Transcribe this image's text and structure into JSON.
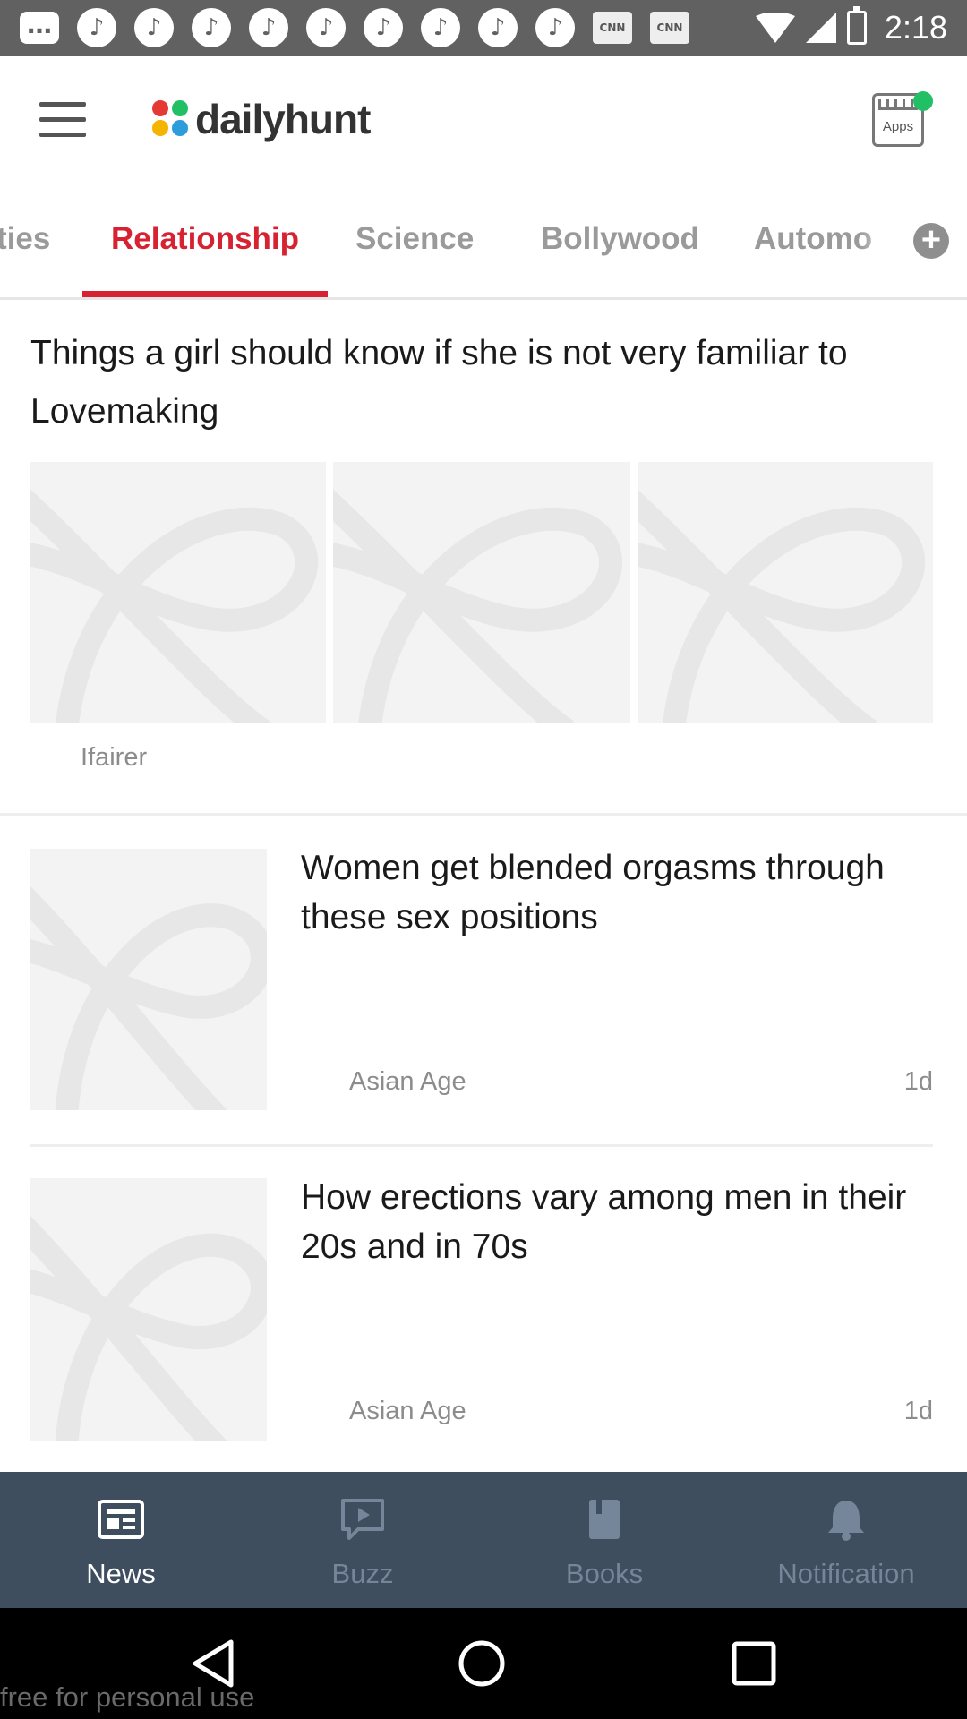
{
  "status_bar": {
    "time": "2:18",
    "left_icons": [
      "message-icon",
      "beats-icon",
      "beats-icon",
      "beats-icon",
      "beats-icon",
      "beats-icon",
      "beats-icon",
      "beats-icon",
      "beats-icon",
      "beats-icon",
      "cnn-icon",
      "cnn-icon"
    ],
    "cnn_label": "CNN"
  },
  "app_bar": {
    "logo_text": "dailyhunt",
    "apps_label": "Apps",
    "logo_colors": [
      "#e53935",
      "#21c065",
      "#f5b400",
      "#2d9cdb"
    ],
    "notification_dot_color": "#21c065"
  },
  "tabs": {
    "items": [
      "ties",
      "Relationship",
      "Science",
      "Bollywood",
      "Automo"
    ],
    "active_index": 1,
    "active_color": "#d62231"
  },
  "feed": {
    "card1": {
      "title": "Things a girl should know if she is not very familiar to Lovemaking",
      "source": "Ifairer"
    },
    "stories": [
      {
        "title": "Women get blended orgasms through these sex positions",
        "source": "Asian Age",
        "age": "1d"
      },
      {
        "title": "How erections vary among men in their 20s and in 70s",
        "source": "Asian Age",
        "age": "1d"
      }
    ]
  },
  "bottom_nav": {
    "items": [
      {
        "label": "News",
        "icon": "newspaper-icon",
        "active": true
      },
      {
        "label": "Buzz",
        "icon": "play-chat-icon",
        "active": false
      },
      {
        "label": "Books",
        "icon": "book-icon",
        "active": false
      },
      {
        "label": "Notification",
        "icon": "bell-icon",
        "active": false
      }
    ],
    "background": "#3e4e5e"
  },
  "watermark": "free for personal use"
}
